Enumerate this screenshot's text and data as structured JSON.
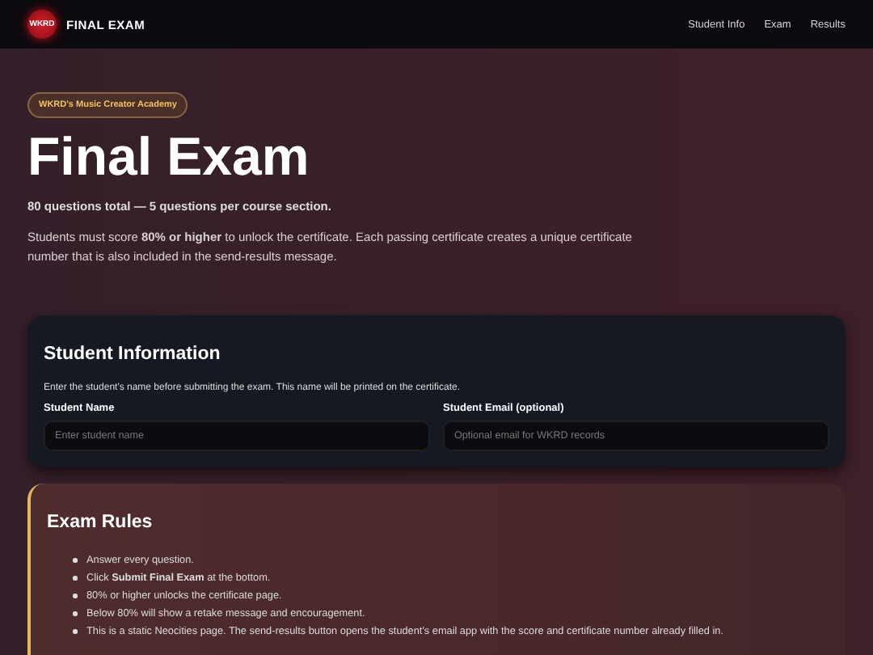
{
  "header": {
    "logo": "WKRD",
    "title": "FINAL EXAM",
    "nav": [
      "Student Info",
      "Exam",
      "Results"
    ]
  },
  "hero": {
    "badge": "WKRD's Music Creator Academy",
    "title": "Final Exam",
    "subtitle": "80 questions total — 5 questions per course section.",
    "description": "Students must score **80% or higher** to unlock the certificate. Each passing certificate creates a unique certificate number that is also included in the send-results message."
  },
  "student_info": {
    "title": "Student Information",
    "note": "Enter the student's name before submitting the exam. This name will be printed on the certificate.",
    "fields": [
      {
        "label": "Student Name",
        "placeholder": "Enter student name"
      },
      {
        "label": "Student Email (optional)",
        "placeholder": "Optional email for WKRD records"
      }
    ]
  },
  "rules": {
    "title": "Exam Rules",
    "items": [
      "Answer every question.",
      "Click **Submit Final Exam** at the bottom.",
      "80% or higher unlocks the certificate page.",
      "Below 80% will show a retake message and encouragement.",
      "This is a static Neocities page. The send-results button opens the student's email app with the score and certificate number already filled in."
    ]
  }
}
